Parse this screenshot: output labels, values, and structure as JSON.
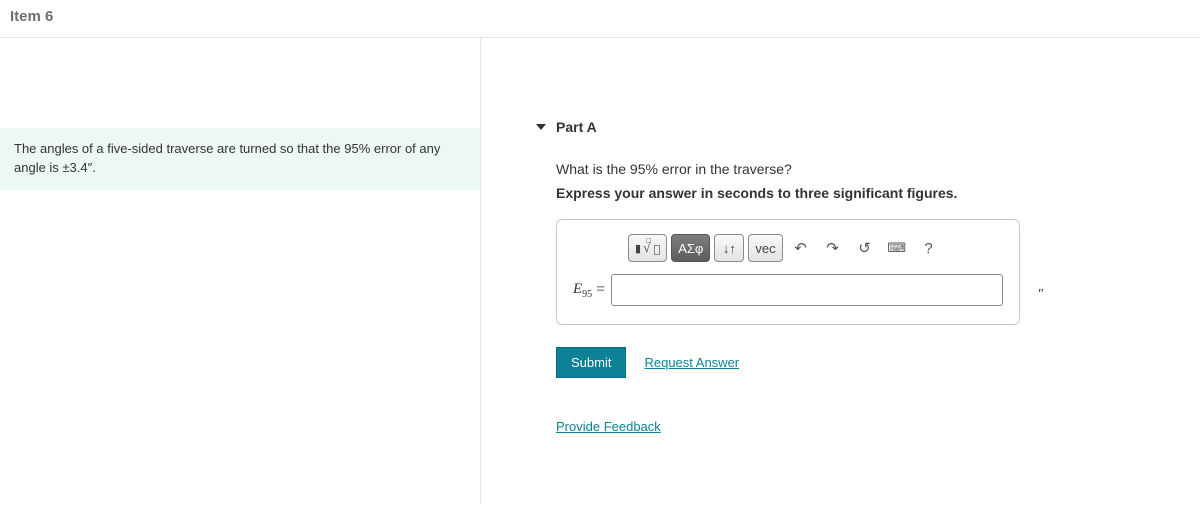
{
  "header": {
    "title": "Item 6"
  },
  "problem": {
    "text_pre": "The angles of a five-sided traverse are turned so that the ",
    "percent1": "95%",
    "text_mid": " error of any angle is ",
    "pm": "±3.4″",
    "text_post": "."
  },
  "part": {
    "label": "Part A",
    "question_pre": "What is the ",
    "question_pct": "95%",
    "question_post": " error in the traverse?",
    "instruction": "Express your answer in seconds to three significant figures.",
    "var_letter": "E",
    "var_sub": "95",
    "equals": "=",
    "answer_value": "",
    "unit_mark": "″"
  },
  "toolbar": {
    "templates": "√",
    "greek": "ΑΣφ",
    "subsup": "↓↑",
    "vec": "vec",
    "undo": "↶",
    "redo": "↷",
    "reset": "↺",
    "keyboard": "⌨",
    "help": "?"
  },
  "actions": {
    "submit": "Submit",
    "request": "Request Answer",
    "feedback": "Provide Feedback"
  }
}
